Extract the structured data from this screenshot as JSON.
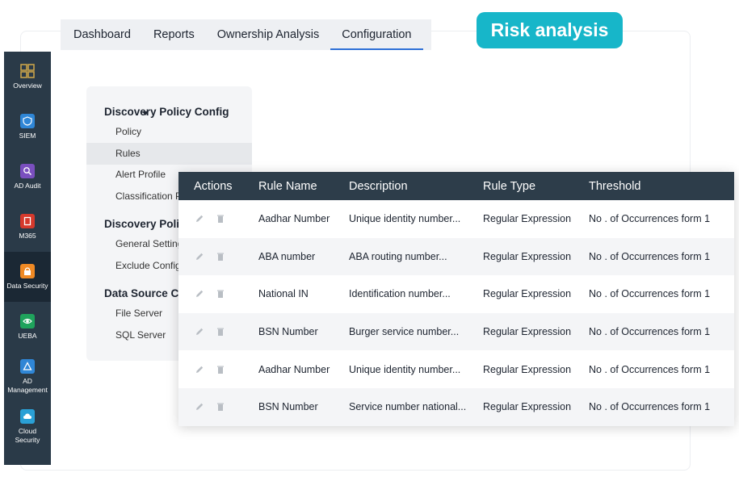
{
  "tabs": [
    {
      "label": "Dashboard"
    },
    {
      "label": "Reports"
    },
    {
      "label": "Ownership Analysis"
    },
    {
      "label": "Configuration",
      "active": true
    }
  ],
  "badge": {
    "label": "Risk analysis",
    "color": "#17b6c9"
  },
  "sidebar": {
    "items": [
      {
        "label": "Overview",
        "icon": "overview-icon",
        "color": "#c9a24a"
      },
      {
        "label": "SIEM",
        "icon": "siem-icon",
        "color": "#2f86d6"
      },
      {
        "label": "AD Audit",
        "icon": "ad-audit-icon",
        "color": "#7a4fbf"
      },
      {
        "label": "M365",
        "icon": "m365-icon",
        "color": "#d6392c"
      },
      {
        "label": "Data Security",
        "icon": "data-security-icon",
        "color": "#f08a24",
        "active": true
      },
      {
        "label": "UEBA",
        "icon": "ueba-icon",
        "color": "#1fa35c"
      },
      {
        "label": "AD\nManagement",
        "icon": "ad-management-icon",
        "color": "#2f86d6"
      },
      {
        "label": "Cloud\nSecurity",
        "icon": "cloud-security-icon",
        "color": "#2aa0d6"
      }
    ]
  },
  "tree": {
    "sections": [
      {
        "title": "Discovery Policy Config",
        "items": [
          "Policy",
          "Rules",
          "Alert Profile",
          "Classification P"
        ]
      },
      {
        "title": "Discovery Polic",
        "items": [
          "General Setting",
          "Exclude Configu"
        ]
      },
      {
        "title": "Data Source Co",
        "items": [
          "File Server",
          "SQL Server"
        ]
      }
    ],
    "selected": "Rules"
  },
  "table": {
    "headers": {
      "actions": "Actions",
      "rule_name": "Rule Name",
      "description": "Description",
      "rule_type": "Rule Type",
      "threshold": "Threshold"
    },
    "rows": [
      {
        "rule_name": "Aadhar Number",
        "description": "Unique identity number...",
        "rule_type": "Regular Expression",
        "threshold": "No . of Occurrences form 1"
      },
      {
        "rule_name": "ABA number",
        "description": "ABA routing number...",
        "rule_type": "Regular Expression",
        "threshold": "No . of Occurrences form 1"
      },
      {
        "rule_name": "National IN",
        "description": "Identification number...",
        "rule_type": "Regular Expression",
        "threshold": "No . of Occurrences form 1"
      },
      {
        "rule_name": "BSN Number",
        "description": "Burger service number...",
        "rule_type": "Regular Expression",
        "threshold": "No . of Occurrences form 1"
      },
      {
        "rule_name": "Aadhar Number",
        "description": "Unique identity number...",
        "rule_type": "Regular Expression",
        "threshold": "No . of Occurrences form 1"
      },
      {
        "rule_name": "BSN Number",
        "description": "Service number national...",
        "rule_type": "Regular Expression",
        "threshold": "No . of Occurrences form 1"
      }
    ]
  }
}
